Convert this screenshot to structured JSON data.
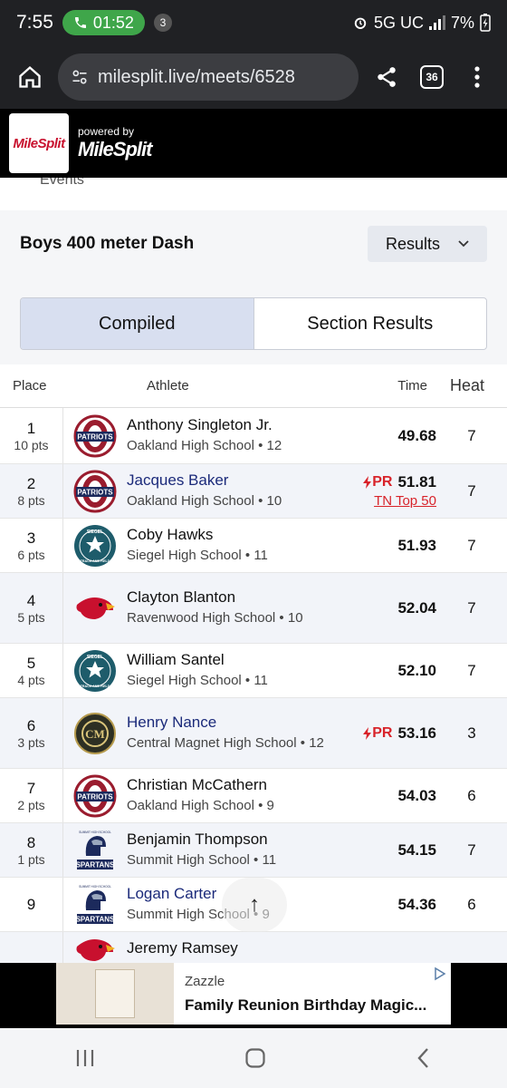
{
  "status_bar": {
    "time": "7:55",
    "call_timer": "01:52",
    "notification_count": "3",
    "network": "5G UC",
    "battery": "7%"
  },
  "browser": {
    "url": "milesplit.live/meets/6528",
    "tab_count": "36"
  },
  "site_header": {
    "logo_text": "MileSplit",
    "powered_by": "powered by",
    "brand": "MileSplit"
  },
  "back_link": "All Events",
  "event": {
    "title": "Boys 400 meter Dash",
    "view_select": "Results"
  },
  "toggle": {
    "compiled": "Compiled",
    "section_results": "Section Results"
  },
  "table": {
    "headers": {
      "place": "Place",
      "athlete": "Athlete",
      "time": "Time",
      "heat": "Heat"
    },
    "rows": [
      {
        "place": "1",
        "pts": "10 pts",
        "name": "Anthony Singleton Jr.",
        "school": "Oakland High School • 12",
        "time": "49.68",
        "pr": "",
        "rank": "",
        "heat": "7",
        "logo": "patriots"
      },
      {
        "place": "2",
        "pts": "8 pts",
        "name": "Jacques Baker",
        "school": "Oakland High School • 10",
        "time": "51.81",
        "pr": "PR",
        "rank": "TN Top 50",
        "heat": "7",
        "logo": "patriots"
      },
      {
        "place": "3",
        "pts": "6 pts",
        "name": "Coby Hawks",
        "school": "Siegel High School • 11",
        "time": "51.93",
        "pr": "",
        "rank": "",
        "heat": "7",
        "logo": "siegel"
      },
      {
        "place": "4",
        "pts": "5 pts",
        "name": "Clayton Blanton",
        "school": "Ravenwood High School • 10",
        "time": "52.04",
        "pr": "",
        "rank": "",
        "heat": "7",
        "logo": "ravenwood"
      },
      {
        "place": "5",
        "pts": "4 pts",
        "name": "William Santel",
        "school": "Siegel High School • 11",
        "time": "52.10",
        "pr": "",
        "rank": "",
        "heat": "7",
        "logo": "siegel"
      },
      {
        "place": "6",
        "pts": "3 pts",
        "name": "Henry Nance",
        "school": "Central Magnet High School • 12",
        "time": "53.16",
        "pr": "PR",
        "rank": "",
        "heat": "3",
        "logo": "central"
      },
      {
        "place": "7",
        "pts": "2 pts",
        "name": "Christian McCathern",
        "school": "Oakland High School • 9",
        "time": "54.03",
        "pr": "",
        "rank": "",
        "heat": "6",
        "logo": "patriots"
      },
      {
        "place": "8",
        "pts": "1 pts",
        "name": "Benjamin Thompson",
        "school": "Summit High School • 11",
        "time": "54.15",
        "pr": "",
        "rank": "",
        "heat": "7",
        "logo": "spartans"
      },
      {
        "place": "9",
        "pts": "",
        "name": "Logan Carter",
        "school": "Summit High School • 9",
        "time": "54.36",
        "pr": "",
        "rank": "",
        "heat": "6",
        "logo": "spartans"
      },
      {
        "place": "",
        "pts": "",
        "name": "Jeremy Ramsey",
        "school": "",
        "time": "",
        "pr": "",
        "rank": "",
        "heat": "",
        "logo": "ravenwood"
      }
    ]
  },
  "ad": {
    "brand": "Zazzle",
    "title": "Family Reunion Birthday Magic..."
  },
  "logo_labels": {
    "patriots": "PATRIOTS",
    "siegel_top": "SIEGEL",
    "siegel_bottom": "TRACK AND FIELD",
    "spartans": "SPARTANS",
    "spartans_top": "SUMMIT HIGH SCHOOL",
    "central": "CM"
  },
  "colors": {
    "link": "#1b2a7a",
    "pr": "#d8232a",
    "accent_active": "#d8dff0"
  }
}
